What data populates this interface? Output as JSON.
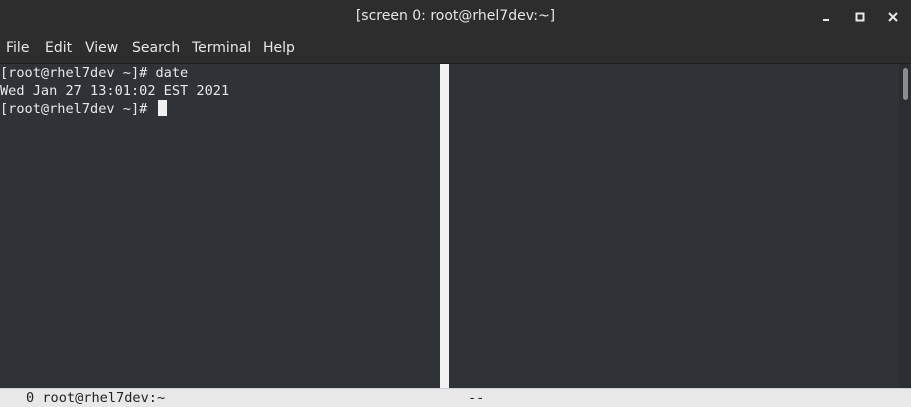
{
  "window": {
    "title": "[screen 0: root@rhel7dev:~]",
    "controls": {
      "minimize": "minimize-icon",
      "maximize": "maximize-icon",
      "close": "close-icon"
    }
  },
  "menubar": {
    "items": [
      {
        "label": "File"
      },
      {
        "label": "Edit"
      },
      {
        "label": "View"
      },
      {
        "label": "Search"
      },
      {
        "label": "Terminal"
      },
      {
        "label": "Help"
      }
    ]
  },
  "terminal": {
    "lines": [
      "[root@rhel7dev ~]# date",
      "Wed Jan 27 13:01:02 EST 2021",
      "[root@rhel7dev ~]# "
    ]
  },
  "statusbar": {
    "left": "0 root@rhel7dev:~",
    "right": "--"
  },
  "colors": {
    "terminal_bg": "#2f3337",
    "terminal_fg": "#e8e8e8",
    "chrome_bg": "#2d2d2d",
    "statusbar_bg": "#e8e8e8",
    "divider": "#f2f2f2"
  }
}
